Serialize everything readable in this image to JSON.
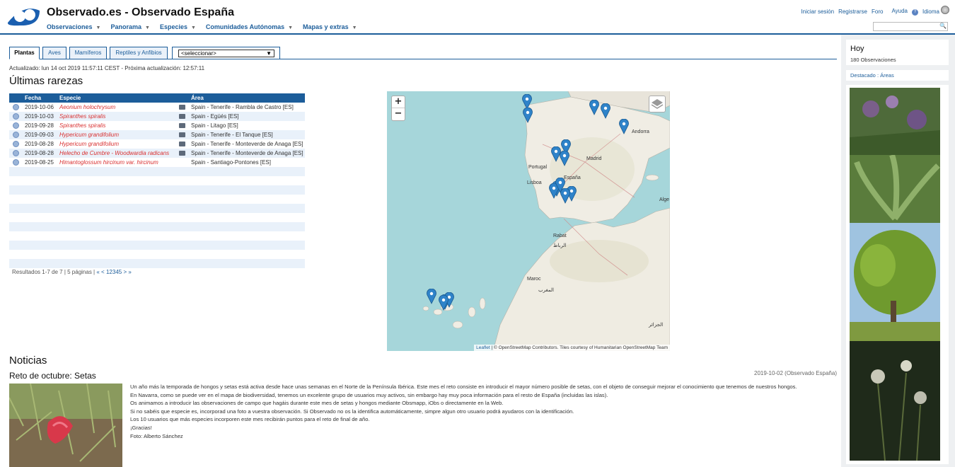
{
  "header": {
    "title": "Observado.es - Observado España",
    "nav": [
      "Observaciones",
      "Panorama",
      "Especies",
      "Comunidades Autónomas",
      "Mapas y extras"
    ],
    "links": {
      "login": "Iniciar sesión",
      "register": "Registrarse",
      "forum": "Foro",
      "help": "Ayuda",
      "language": "Idioma"
    },
    "search_placeholder": ""
  },
  "tabs": [
    "Plantas",
    "Aves",
    "Mamíferos",
    "Reptiles y Anfibios"
  ],
  "select_value": "<seleccionar>",
  "updated": "Actualizado: lun 14 oct 2019 11:57:11 CEST - Próxima actualización: 12:57:11",
  "rarities": {
    "title": "Últimas rarezas",
    "columns": {
      "date": "Fecha",
      "species": "Especie",
      "area": "Área"
    },
    "rows": [
      {
        "date": "2019-10-06",
        "species": "Aeonium holochrysum",
        "area": "Spain - Tenerife - Rambla de Castro [ES]",
        "photo": true
      },
      {
        "date": "2019-10-03",
        "species": "Spiranthes spiralis",
        "area": "Spain - Egüés [ES]",
        "photo": true
      },
      {
        "date": "2019-09-28",
        "species": "Spiranthes spiralis",
        "area": "Spain - Litago [ES]",
        "photo": true
      },
      {
        "date": "2019-09-03",
        "species": "Hypericum grandifolium",
        "area": "Spain - Tenerife - El Tanque [ES]",
        "photo": true
      },
      {
        "date": "2019-08-28",
        "species": "Hypericum grandifolium",
        "area": "Spain - Tenerife - Monteverde de Anaga [ES]",
        "photo": true
      },
      {
        "date": "2019-08-28",
        "species": "Helecho de Cumbre - Woodwardia radicans",
        "area": "Spain - Tenerife - Monteverde de Anaga [ES]",
        "photo": true
      },
      {
        "date": "2019-08-25",
        "species": "Himantoglossum hircinum var. hircinum",
        "area": "Spain - Santiago-Pontones [ES]",
        "photo": false
      }
    ],
    "pager": {
      "summary": "Resultados 1-7 de 7 | 5 páginas |",
      "first": "«",
      "prev": "<",
      "pages": [
        "1",
        "2",
        "3",
        "4",
        "5"
      ],
      "next": ">",
      "last": "»"
    }
  },
  "map": {
    "zoom_in": "+",
    "zoom_out": "−",
    "labels": [
      "Andorra",
      "Portugal",
      "Madrid",
      "España",
      "Lisboa",
      "Alge",
      "Rabat",
      "الرباط",
      "Maroc",
      "المغرب",
      "الجزائر"
    ],
    "attribution_link": "Leaflet",
    "attribution_text": "| © OpenStreetMap Contributors. Tiles courtesy of Humanitarian OpenStreetMap Team"
  },
  "news": {
    "title": "Noticias",
    "headline": "Reto de octubre: Setas",
    "date": "2019-10-02 (Observado España)",
    "paragraphs": [
      "Un año más la temporada de hongos y setas está activa desde hace unas semanas en el Norte de la Península Ibérica. Este mes el reto consiste en introducir el mayor número posible de setas, con el objeto de conseguir mejorar el conocimiento que tenemos de nuestros hongos.",
      "En Navarra, como se puede ver en el mapa de biodiversidad, tenemos un excelente grupo de usuarios muy activos, sin embargo hay muy poca información para el resto de España (incluidas las islas).",
      "Os animamos a introducir las observaciones de campo que hagáis durante este mes de setas y hongos mediante Obsmapp, iObs o directamente en la Web.",
      "Si no sabéis que especie es, incorporad una foto a vuestra observación. Si Observado no os la identifica automáticamente, simpre algun otro usuario podrá ayudaros con la identificación.",
      "Los 10 usuarios que más especies incorporen este mes recibirán puntos para el reto de final de año.",
      "¡Gracias!",
      "Foto: Alberto Sánchez"
    ]
  },
  "sidebar": {
    "today_title": "Hoy",
    "today_count": "180 Observaciones",
    "featured": "Destacado : Áreas"
  }
}
